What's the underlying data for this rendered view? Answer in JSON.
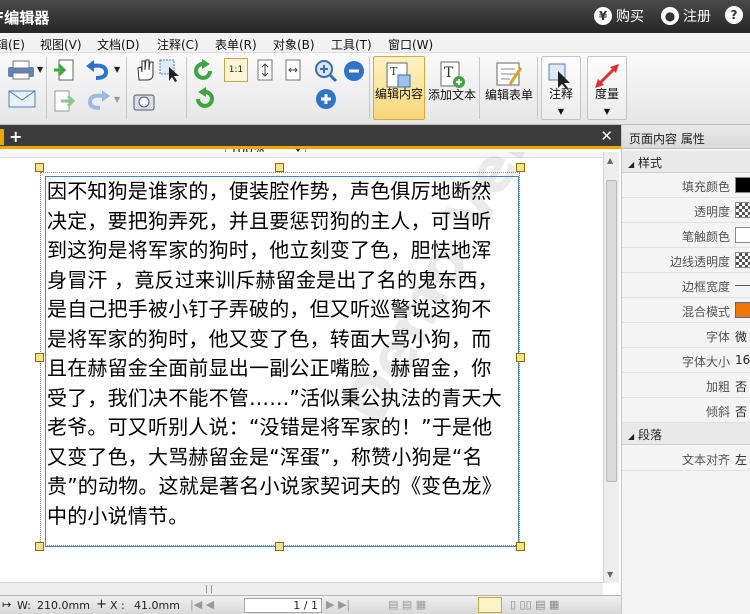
{
  "titlebar": {
    "title": "F编辑器",
    "buy_label": "购买",
    "register_label": "注册"
  },
  "menubar": {
    "items": [
      "辑(E)",
      "视图(V)",
      "文档(D)",
      "注释(C)",
      "表单(R)",
      "对象(B)",
      "工具(T)",
      "窗口(W)"
    ]
  },
  "toolbar": {
    "zoom_value": "100%",
    "edit_content_label": "编辑内容",
    "add_text_label": "添加文本",
    "edit_form_label": "编辑表单",
    "comment_label": "注释",
    "measure_label": "度量"
  },
  "document": {
    "watermark": "Demo Version",
    "body_text": "因不知狗是谁家的，便装腔作势，声色俱厉地断然决定，要把狗弄死，并且要惩罚狗的主人，可当听到这狗是将军家的狗时，他立刻变了色，胆怯地浑身冒汗 ，竟反过来训斥赫留金是出了名的鬼东西，是自己把手被小钉子弄破的，但又听巡警说这狗不是将军家的狗时，他又变了色，转面大骂小狗，而且在赫留金全面前显出一副公正嘴脸，赫留金，你受了，我们决不能不管……”活似秉公执法的青天大老爷。可又听别人说：“没错是将军家的！”于是他又变了色，大骂赫留金是“浑蛋”，称赞小狗是“名贵”的动物。这就是著名小说家契诃夫的《变色龙》中的小说情节。"
  },
  "statusbar": {
    "width_label": "W:",
    "width_value": "210.0mm",
    "x_label": "X :",
    "x_value": "41.0mm",
    "page_indicator": "1 / 1"
  },
  "panel": {
    "header": "页面内容 属性",
    "style_section": "样式",
    "paragraph_section": "段落",
    "rows": [
      {
        "key": "填充颜色",
        "value": ""
      },
      {
        "key": "透明度",
        "value": ""
      },
      {
        "key": "笔触颜色",
        "value": ""
      },
      {
        "key": "边线透明度",
        "value": ""
      },
      {
        "key": "边框宽度",
        "value": ""
      },
      {
        "key": "混合模式",
        "value": ""
      },
      {
        "key": "字体",
        "value": "微"
      },
      {
        "key": "字体大小",
        "value": "16"
      },
      {
        "key": "加粗",
        "value": "否"
      },
      {
        "key": "倾斜",
        "value": "否"
      }
    ],
    "align_key": "文本对齐",
    "align_value": "左"
  },
  "colors": {
    "fill": "#000000",
    "stroke": "#ffffff",
    "blend": "#f07800",
    "accent": "#f0a500"
  }
}
